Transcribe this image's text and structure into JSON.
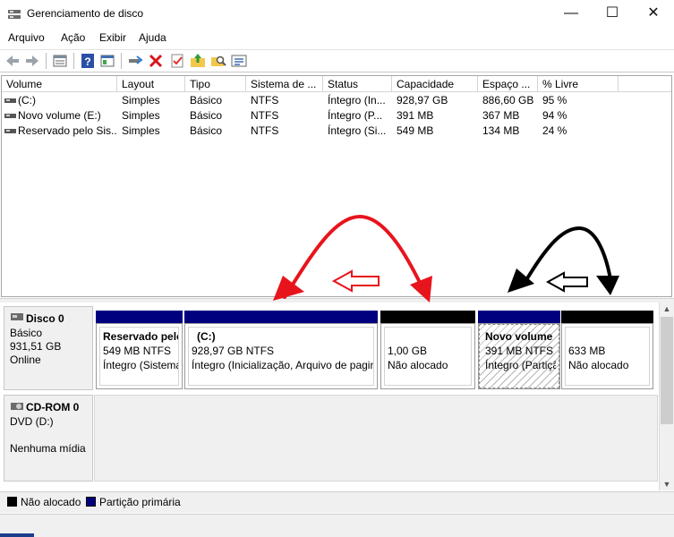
{
  "window": {
    "title": "Gerenciamento de disco",
    "minimize_glyph": "—",
    "maximize_glyph": "☐",
    "close_glyph": "✕"
  },
  "menu": [
    "Arquivo",
    "Ação",
    "Exibir",
    "Ajuda"
  ],
  "toolbar": {
    "icons": [
      "back-arrow-icon",
      "forward-arrow-icon",
      "list-view-icon",
      "help-icon",
      "console-tree-icon",
      "connect-drive-icon",
      "delete-icon",
      "check-icon",
      "folder-up-icon",
      "search-folder-icon",
      "properties-icon"
    ]
  },
  "volumes": {
    "columns": [
      "Volume",
      "Layout",
      "Tipo",
      "Sistema de ...",
      "Status",
      "Capacidade",
      "Espaço ...",
      "% Livre"
    ],
    "rows": [
      [
        "(C:)",
        "Simples",
        "Básico",
        "NTFS",
        "Íntegro (In...",
        "928,97 GB",
        "886,60 GB",
        "95 %"
      ],
      [
        "Novo volume (E:)",
        "Simples",
        "Básico",
        "NTFS",
        "Íntegro (P...",
        "391 MB",
        "367 MB",
        "94 %"
      ],
      [
        "Reservado pelo Sis...",
        "Simples",
        "Básico",
        "NTFS",
        "Íntegro (Si...",
        "549 MB",
        "134 MB",
        "24 %"
      ]
    ]
  },
  "disks": [
    {
      "name": "Disco 0",
      "type": "Básico",
      "size": "931,51 GB",
      "state": "Online",
      "partitions": [
        {
          "title": "Reservado pelo",
          "size": "549 MB NTFS",
          "status": "Íntegro (Sistema",
          "stripe": "navy"
        },
        {
          "title": "(C:)",
          "size": "928,97 GB NTFS",
          "status": "Íntegro (Inicialização, Arquivo de pagin",
          "stripe": "navy"
        },
        {
          "title": "",
          "size": "1,00 GB",
          "status": "Não alocado",
          "stripe": "black"
        },
        {
          "title": "Novo volume",
          "size": "391 MB NTFS",
          "status": "Íntegro (Partiçã",
          "stripe": "navy"
        },
        {
          "title": "",
          "size": "633 MB",
          "status": "Não alocado",
          "stripe": "black"
        }
      ]
    },
    {
      "name": "CD-ROM 0",
      "type": "DVD (D:)",
      "size": "",
      "state": "Nenhuma mídia"
    }
  ],
  "legend": [
    {
      "label": "Não alocado",
      "color": "#000000"
    },
    {
      "label": "Partição primária",
      "color": "#00007f"
    }
  ],
  "annotations": {
    "red_color": "#e8141c",
    "black_color": "#000000"
  }
}
